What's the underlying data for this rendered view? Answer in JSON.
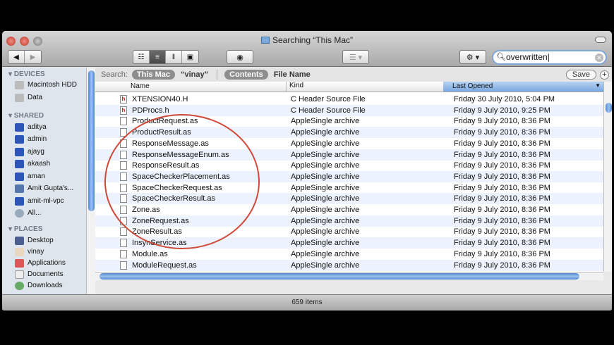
{
  "window": {
    "title": "Searching “This Mac”"
  },
  "toolbar": {
    "back": "◀",
    "forward": "▶",
    "views": [
      "☷",
      "≡",
      "‖",
      "▣"
    ],
    "quicklook": "◉",
    "arrange": "☰ ▾",
    "action": "⚙ ▾",
    "search_value": "overwritten"
  },
  "sidebar": {
    "devices_label": "DEVICES",
    "devices": [
      "Macintosh HDD",
      "Data"
    ],
    "shared_label": "SHARED",
    "shared": [
      "aditya",
      "admin",
      "ajayg",
      "akaash",
      "aman",
      "Amit Gupta's...",
      "amit-ml-vpc",
      "All..."
    ],
    "places_label": "PLACES",
    "places": [
      "Desktop",
      "vinay",
      "Applications",
      "Documents",
      "Downloads"
    ]
  },
  "searchbar": {
    "label": "Search:",
    "scope_this_mac": "This Mac",
    "scope_user": "“vinay”",
    "contents": "Contents",
    "file_name": "File Name",
    "save": "Save",
    "add": "+"
  },
  "columns": {
    "name": "Name",
    "kind": "Kind",
    "last_opened": "Last Opened"
  },
  "files": [
    {
      "name": "XTENSION40.H",
      "kind": "C Header Source File",
      "date": "Friday 30 July 2010, 5:04 PM",
      "icon": "h"
    },
    {
      "name": "PDProcs.h",
      "kind": "C Header Source File",
      "date": "Friday 9 July 2010, 9:25 PM",
      "icon": "h"
    },
    {
      "name": "ProductRequest.as",
      "kind": "AppleSingle archive",
      "date": "Friday 9 July 2010, 8:36 PM"
    },
    {
      "name": "ProductResult.as",
      "kind": "AppleSingle archive",
      "date": "Friday 9 July 2010, 8:36 PM"
    },
    {
      "name": "ResponseMessage.as",
      "kind": "AppleSingle archive",
      "date": "Friday 9 July 2010, 8:36 PM"
    },
    {
      "name": "ResponseMessageEnum.as",
      "kind": "AppleSingle archive",
      "date": "Friday 9 July 2010, 8:36 PM"
    },
    {
      "name": "ResponseResult.as",
      "kind": "AppleSingle archive",
      "date": "Friday 9 July 2010, 8:36 PM"
    },
    {
      "name": "SpaceCheckerPlacement.as",
      "kind": "AppleSingle archive",
      "date": "Friday 9 July 2010, 8:36 PM"
    },
    {
      "name": "SpaceCheckerRequest.as",
      "kind": "AppleSingle archive",
      "date": "Friday 9 July 2010, 8:36 PM"
    },
    {
      "name": "SpaceCheckerResult.as",
      "kind": "AppleSingle archive",
      "date": "Friday 9 July 2010, 8:36 PM"
    },
    {
      "name": "Zone.as",
      "kind": "AppleSingle archive",
      "date": "Friday 9 July 2010, 8:36 PM"
    },
    {
      "name": "ZoneRequest.as",
      "kind": "AppleSingle archive",
      "date": "Friday 9 July 2010, 8:36 PM"
    },
    {
      "name": "ZoneResult.as",
      "kind": "AppleSingle archive",
      "date": "Friday 9 July 2010, 8:36 PM"
    },
    {
      "name": "InsynService.as",
      "kind": "AppleSingle archive",
      "date": "Friday 9 July 2010, 8:36 PM"
    },
    {
      "name": "Module.as",
      "kind": "AppleSingle archive",
      "date": "Friday 9 July 2010, 8:36 PM"
    },
    {
      "name": "ModuleRequest.as",
      "kind": "AppleSingle archive",
      "date": "Friday 9 July 2010, 8:36 PM"
    }
  ],
  "status": {
    "items": "659 items"
  }
}
